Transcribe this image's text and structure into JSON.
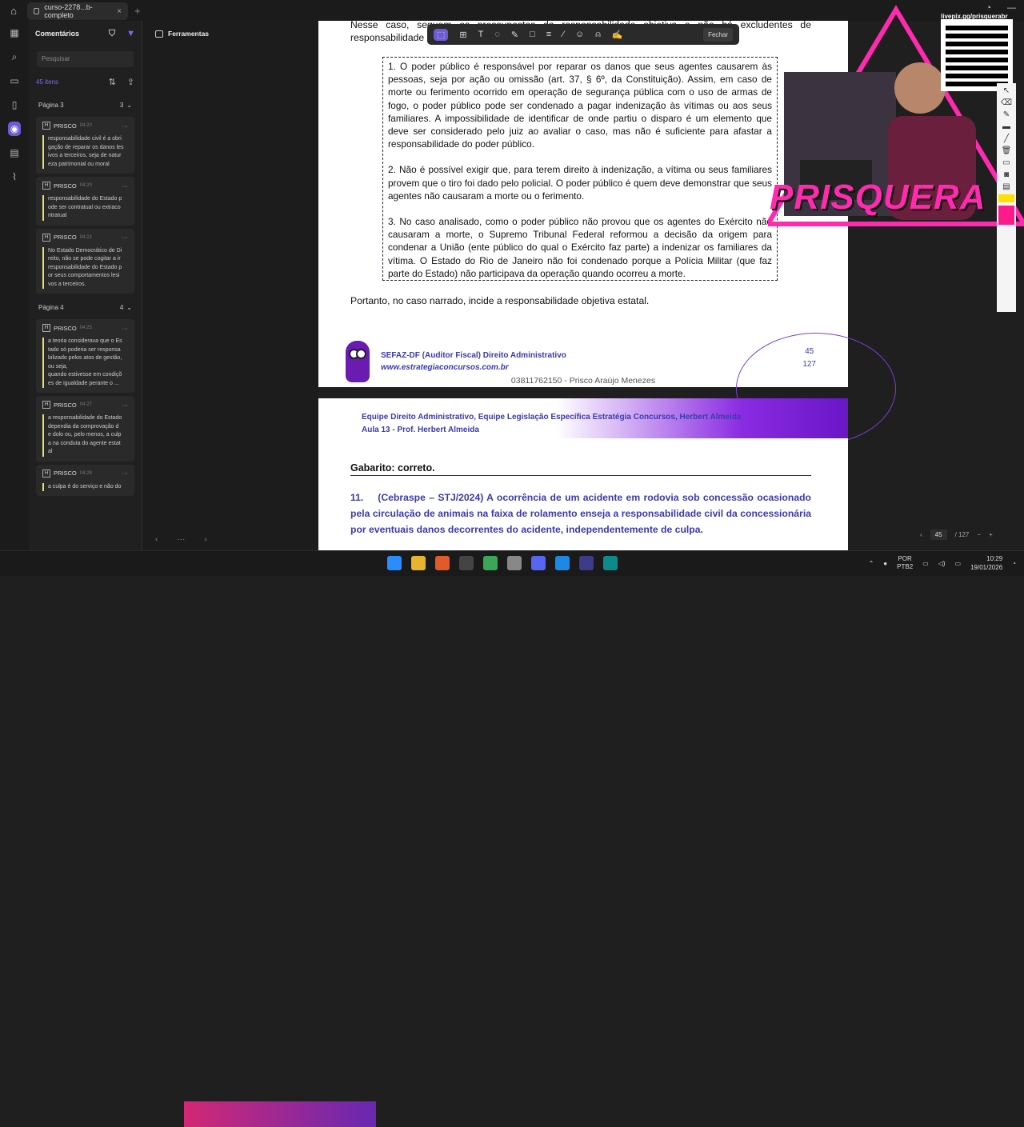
{
  "browser": {
    "tab_title": "curso-2278...b-completo",
    "tab_close": "×",
    "new_tab": "+"
  },
  "comments_panel": {
    "title": "Comentários",
    "search_placeholder": "Pesquisar",
    "count": "45 itens",
    "groups": [
      {
        "page_label": "Página 3",
        "page_count": "3",
        "items": [
          {
            "author": "PRISCO",
            "time": "04:20",
            "text": "responsabilidade civil é a obri\ngação de reparar os danos les\nivos a terceiros, seja de natur\neza patrimonial ou moral"
          },
          {
            "author": "PRISCO",
            "time": "04:20",
            "text": "responsabilidade do Estado p\node ser contratual ou extraco\nntratual"
          },
          {
            "author": "PRISCO",
            "time": "04:22",
            "text": "No Estado Democrático de Di\nreito, não se pode cogitar a ir\nresponsabilidade do Estado p\nor seus comportamentos lesi\nvos a terceiros."
          }
        ]
      },
      {
        "page_label": "Página 4",
        "page_count": "4",
        "items": [
          {
            "author": "PRISCO",
            "time": "04:25",
            "text": "a teoria considerava que o Es\ntado só poderia ser responsa\nbilizado pelos atos de gestão,\nou seja,\nquando estivesse em condiçõ\nes de igualdade perante o ..."
          },
          {
            "author": "PRISCO",
            "time": "04:27",
            "text": "a responsabilidade do Estado\ndependia da comprovação d\ne dolo ou, pelo menos, a culp\na na conduta do agente estat\nal"
          },
          {
            "author": "PRISCO",
            "time": "04:28",
            "text": "a culpa é do serviço e não do"
          }
        ]
      }
    ]
  },
  "tools_panel": {
    "title": "Ferramentas"
  },
  "floating_toolbar": {
    "close_label": "Fechar"
  },
  "document": {
    "page1": {
      "intro": "Nesse caso, seguem os pressupostos da responsabilidade objetiva e não há excludentes de responsabilidade",
      "quote": [
        "1. O poder público é responsável por reparar os danos que seus agentes causarem às pessoas, seja por ação ou omissão (art. 37, § 6º, da Constituição). Assim, em caso de morte ou ferimento ocorrido em operação de segurança pública com o uso de armas de fogo, o poder público pode ser condenado a pagar indenização às vítimas ou aos seus familiares. A impossibilidade de identificar de onde partiu o disparo é um elemento que deve ser considerado pelo juiz ao avaliar o caso, mas não é suficiente para afastar a responsabilidade do poder público.",
        "2. Não é possível exigir que, para terem direito à indenização, a vítima ou seus familiares provem que o tiro foi dado pelo policial. O poder público é quem deve demonstrar que seus agentes não causaram a morte ou o ferimento.",
        "3. No caso analisado, como o poder público não provou que os agentes do Exército não causaram a morte, o Supremo Tribunal Federal reformou a decisão da origem para condenar a União (ente público do qual o Exército faz parte) a indenizar os familiares da vítima. O Estado do Rio de Janeiro não foi condenado porque a Polícia Militar (que faz parte do Estado) não participava da operação quando ocorreu a morte."
      ],
      "conclusion": "Portanto, no caso narrado, incide a responsabilidade objetiva estatal.",
      "footer_title": "SEFAZ-DF (Auditor Fiscal) Direito Administrativo",
      "footer_url": "www.estrategiaconcursos.com.br",
      "page_number": "45",
      "total_pages": "127",
      "cpf_line": "03811762150 - Prisco Araújo Menezes"
    },
    "page2": {
      "header_line1": "Equipe Direito Administrativo, Equipe Legislação Específica Estratégia Concursos, Herbert Almeida",
      "header_line2": "Aula 13 - Prof. Herbert Almeida",
      "gabarito": "Gabarito: correto.",
      "question_number": "11.",
      "question_text": "(Cebraspe – STJ/2024) A ocorrência de um acidente em rodovia sob concessão ocasionado pela circulação de animais na faixa de rolamento enseja a responsabilidade civil da concessionária por eventuais danos decorrentes do acidente, independentemente de culpa."
    }
  },
  "pager": {
    "current": "45",
    "total": "/ 127"
  },
  "stream_overlay": {
    "qr_label": "livepix.gg/prisquerabr",
    "logo": "PRISQUERA"
  },
  "taskbar": {
    "lang_line1": "POR",
    "lang_line2": "PTB2",
    "time": "10:29",
    "date": "19/01/2026"
  },
  "colors": {
    "accent": "#6b5cd6",
    "highlight_bar": "#e3e36a",
    "doc_blue": "#3a3ab0",
    "stream_pink": "#ff2ab0"
  }
}
